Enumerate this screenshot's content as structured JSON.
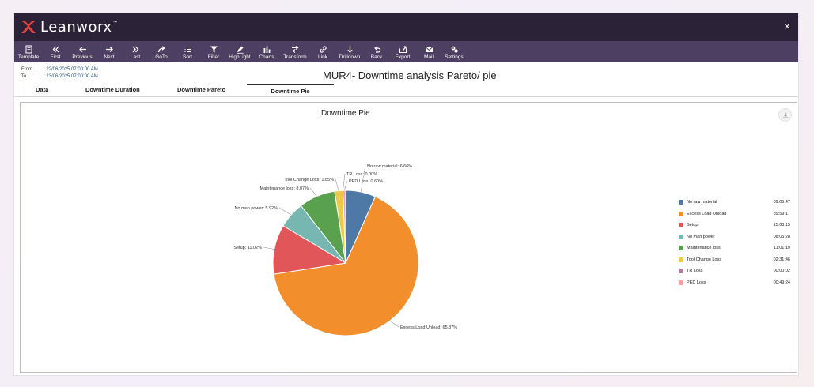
{
  "app": {
    "brand": "Leanworx",
    "brand_tm": "™",
    "close": "×"
  },
  "toolbar": [
    {
      "label": "Template",
      "icon": "template-icon"
    },
    {
      "label": "First",
      "icon": "first-icon"
    },
    {
      "label": "Previous",
      "icon": "previous-icon"
    },
    {
      "label": "Next",
      "icon": "next-icon"
    },
    {
      "label": "Last",
      "icon": "last-icon"
    },
    {
      "label": "GoTo",
      "icon": "goto-icon"
    },
    {
      "label": "Sort",
      "icon": "sort-icon"
    },
    {
      "label": "Filter",
      "icon": "filter-icon"
    },
    {
      "label": "HighLight",
      "icon": "highlight-icon"
    },
    {
      "label": "Charts",
      "icon": "charts-icon"
    },
    {
      "label": "Transform",
      "icon": "transform-icon"
    },
    {
      "label": "Link",
      "icon": "link-icon"
    },
    {
      "label": "Drilldown",
      "icon": "drilldown-icon"
    },
    {
      "label": "Back",
      "icon": "back-icon"
    },
    {
      "label": "Export",
      "icon": "export-icon"
    },
    {
      "label": "Mail",
      "icon": "mail-icon"
    },
    {
      "label": "Settings",
      "icon": "settings-icon"
    }
  ],
  "header": {
    "from_label": "From",
    "from_value": ": 22/06/2025 07:00:00 AM",
    "to_label": "To",
    "to_value": ": 23/06/2025 07:00:00 AM",
    "title": "MUR4- Downtime analysis Pareto/ pie"
  },
  "tabs": [
    {
      "label": "Data"
    },
    {
      "label": "Downtime Duration"
    },
    {
      "label": "Downtime Pareto"
    },
    {
      "label": "Downtime Pie",
      "active": true
    }
  ],
  "chart_data": {
    "type": "pie",
    "title": "Downtime Pie",
    "slices": [
      {
        "name": "No raw material",
        "percent": 6.66,
        "label": "No raw material: 6.66%",
        "duration": "09:05:47",
        "color": "#4e79a7"
      },
      {
        "name": "Excess Load Unload",
        "percent": 65.87,
        "label": "Excess Load Unload: 65.87%",
        "duration": "89:59:17",
        "color": "#f28e2b"
      },
      {
        "name": "Setup",
        "percent": 11.02,
        "label": "Setup: 11.02%",
        "duration": "15:03:15",
        "color": "#e15759"
      },
      {
        "name": "No man power",
        "percent": 5.92,
        "label": "No man power: 5.92%",
        "duration": "08:05:28",
        "color": "#76b7b2"
      },
      {
        "name": "Maintenance loss",
        "percent": 8.07,
        "label": "Maintenance loss: 8.07%",
        "duration": "11:01:19",
        "color": "#59a14f"
      },
      {
        "name": "Tool Change Loss",
        "percent": 1.85,
        "label": "Tool Change Loss: 1.85%",
        "duration": "02:31:46",
        "color": "#edc948"
      },
      {
        "name": "TR Loss",
        "percent": 0.0,
        "label": "TR Loss: 0.00%",
        "duration": "00:00:02",
        "color": "#b07aa1"
      },
      {
        "name": "PED Loss",
        "percent": 0.6,
        "label": "PED Loss: 0.60%",
        "duration": "00:49:24",
        "color": "#ff9da7"
      }
    ],
    "legend_position": "right"
  }
}
